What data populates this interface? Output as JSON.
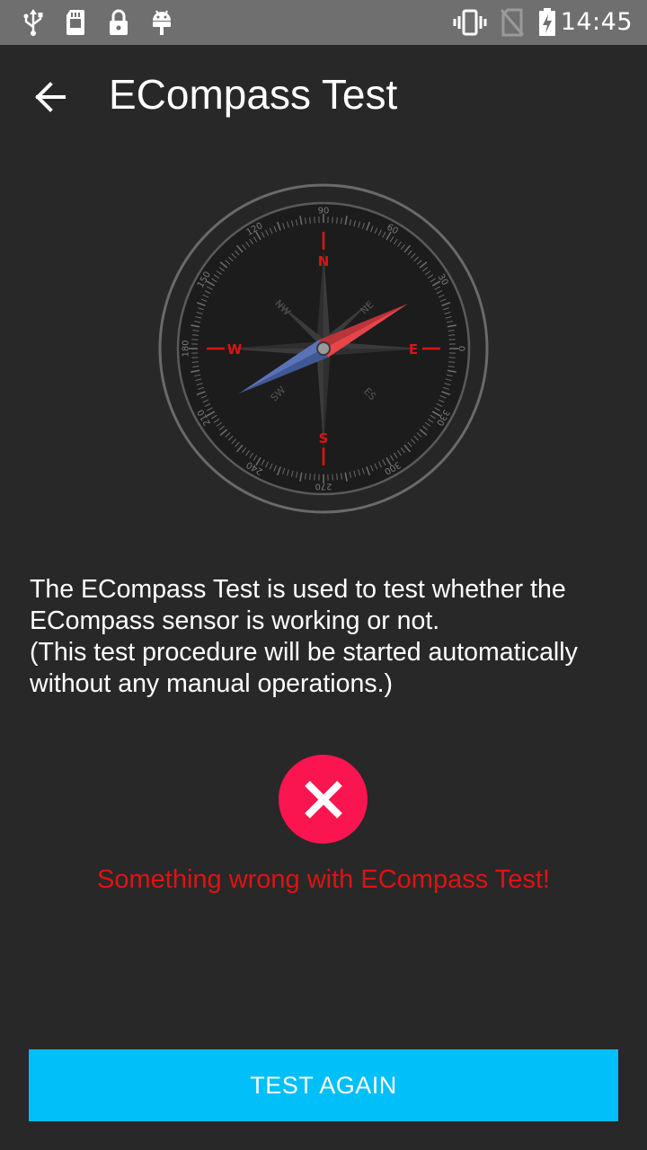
{
  "status_bar": {
    "time": "14:45",
    "left_icons": [
      "usb-icon",
      "sd-card-icon",
      "lock-icon",
      "android-debug-icon"
    ],
    "right_icons": [
      "vibrate-icon",
      "no-sim-icon",
      "battery-charging-icon"
    ]
  },
  "app_bar": {
    "title": "ECompass Test",
    "back_icon": "arrow-left-icon"
  },
  "compass": {
    "cardinals": {
      "north": "N",
      "south": "S",
      "east": "E",
      "west": "W"
    },
    "intercardinals": {
      "nw": "NW",
      "ne": "NE",
      "sw": "SW",
      "se": "ES"
    },
    "degree_labels": [
      "0",
      "30",
      "60",
      "90",
      "120",
      "150",
      "180",
      "210",
      "240",
      "270",
      "300",
      "330"
    ],
    "needle_heading_deg": 62,
    "colors": {
      "north_needle": "#e8454b",
      "south_needle": "#5a73b8",
      "accent_red": "#e01212"
    }
  },
  "description": {
    "line1": "The ECompass Test is used to test whether the ECompass sensor is working or not.",
    "line2": "(This test procedure will be started automatically without any manual operations.)"
  },
  "result": {
    "icon": "close-icon",
    "message": "Something wrong with ECompass Test!",
    "colors": {
      "icon_bg": "#fb1550",
      "message": "#e01212"
    }
  },
  "actions": {
    "test_again_label": "TEST AGAIN",
    "button_color": "#00bff9"
  }
}
